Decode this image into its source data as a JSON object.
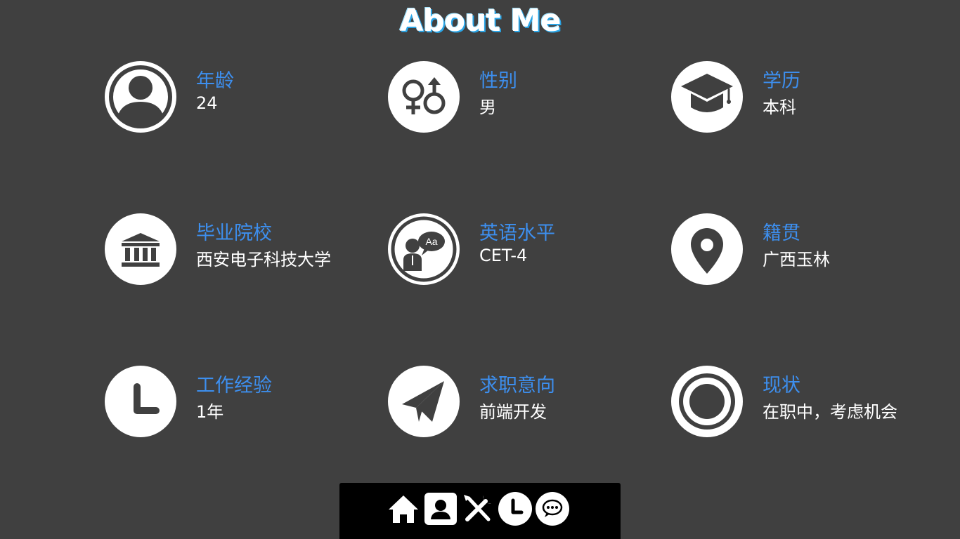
{
  "page": {
    "title": "About Me"
  },
  "items": [
    {
      "id": "age",
      "icon": "user-icon",
      "label": "年龄",
      "value": "24"
    },
    {
      "id": "gender",
      "icon": "gender-icon",
      "label": "性别",
      "value": "男"
    },
    {
      "id": "education",
      "icon": "graduation-cap-icon",
      "label": "学历",
      "value": "本科"
    },
    {
      "id": "school",
      "icon": "university-icon",
      "label": "毕业院校",
      "value": "西安电子科技大学"
    },
    {
      "id": "english",
      "icon": "language-icon",
      "label": "英语水平",
      "value": "CET-4"
    },
    {
      "id": "hometown",
      "icon": "map-pin-icon",
      "label": "籍贯",
      "value": "广西玉林"
    },
    {
      "id": "experience",
      "icon": "clock-icon",
      "label": "工作经验",
      "value": "1年"
    },
    {
      "id": "intention",
      "icon": "paper-plane-icon",
      "label": "求职意向",
      "value": "前端开发"
    },
    {
      "id": "status",
      "icon": "radio-circle-icon",
      "label": "现状",
      "value": "在职中，考虑机会"
    }
  ],
  "nav": [
    {
      "name": "home",
      "icon": "home-icon"
    },
    {
      "name": "about",
      "icon": "contact-icon"
    },
    {
      "name": "skills",
      "icon": "tools-icon"
    },
    {
      "name": "experience",
      "icon": "clock-icon"
    },
    {
      "name": "contact",
      "icon": "chat-bubble-icon"
    }
  ],
  "colors": {
    "background": "#404040",
    "label": "#3d8fef",
    "value": "#ffffff",
    "icon_bg": "#ffffff",
    "icon_fg": "#404040",
    "nav_bg": "#000000"
  }
}
